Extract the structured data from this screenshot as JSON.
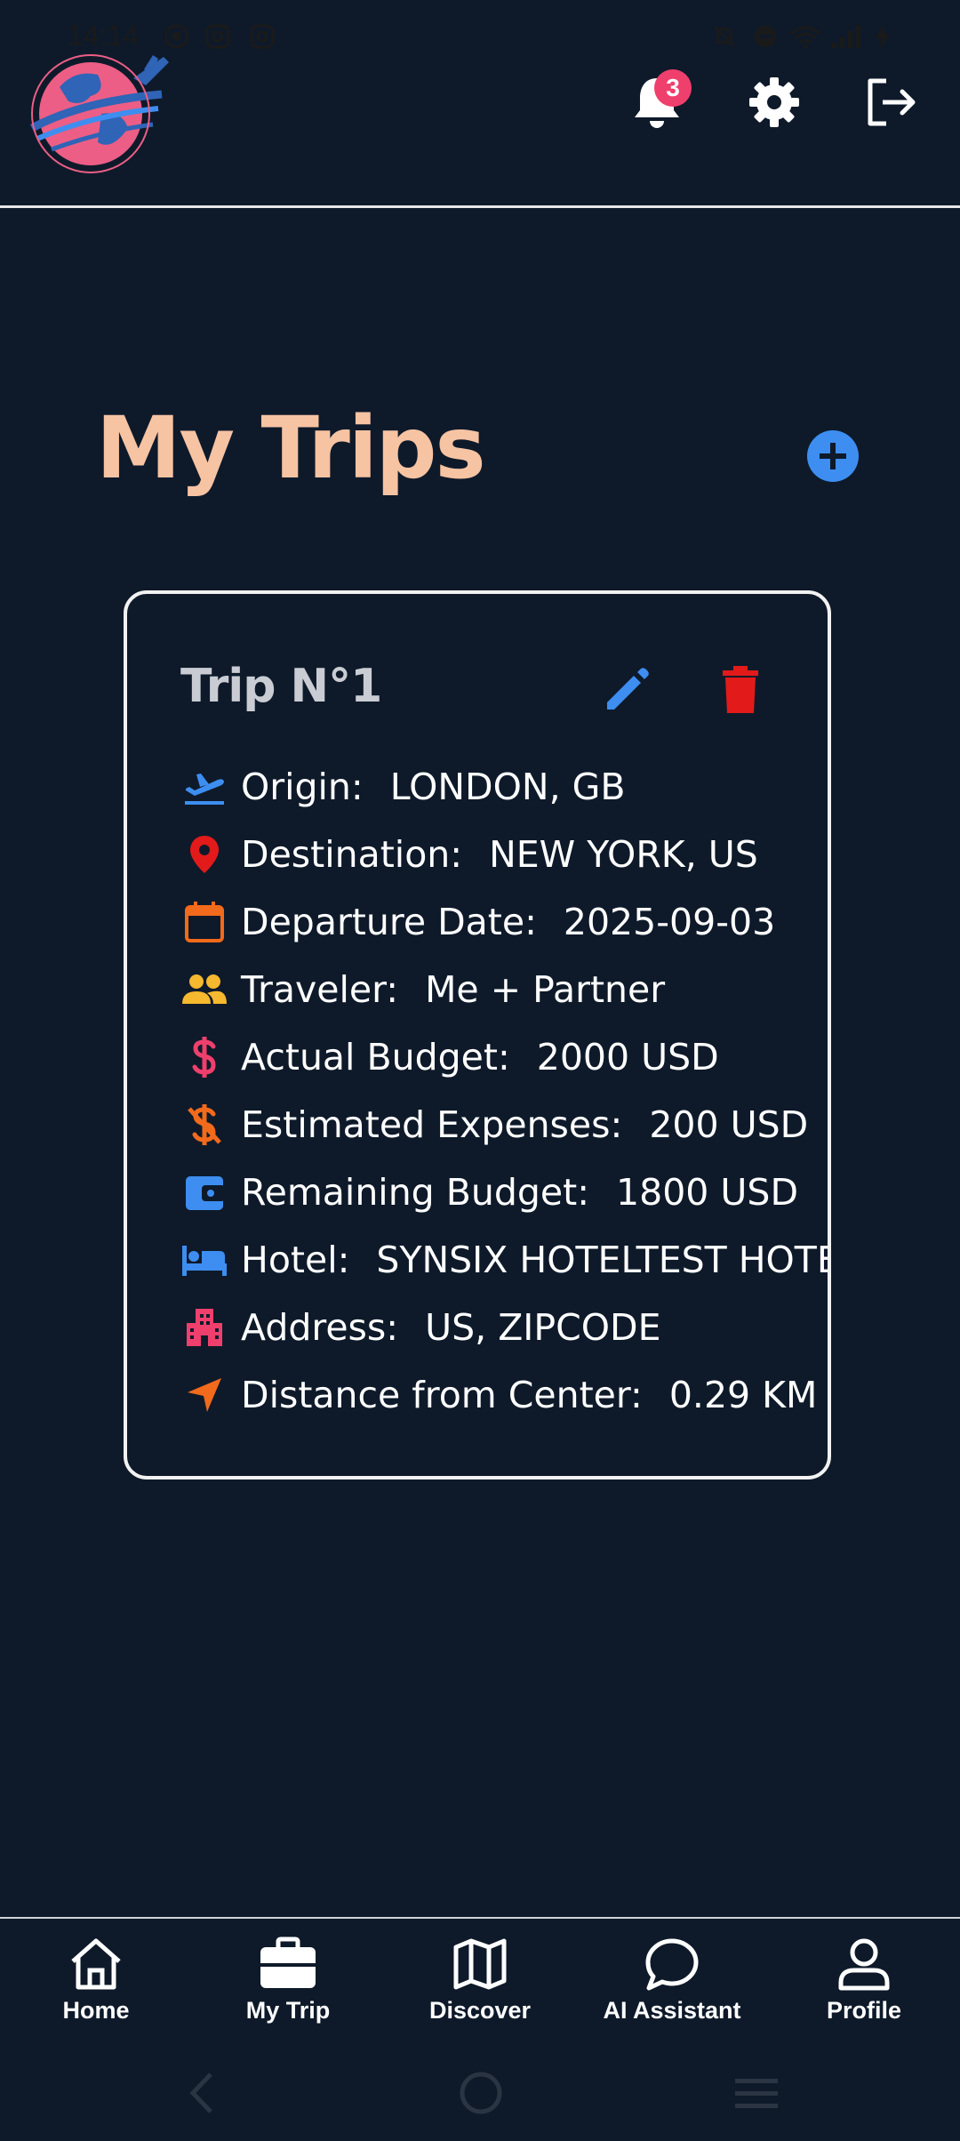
{
  "status_bar": {
    "time": "14:14",
    "left_icons": [
      "app-icon",
      "instagram-icon",
      "instagram-icon"
    ],
    "right_icons": [
      "bell-off-icon",
      "dnd-icon",
      "wifi-icon",
      "signal-icon",
      "battery-icon"
    ]
  },
  "header": {
    "logo": "globe-airplane-logo",
    "notification_count": "3",
    "icons": [
      "bell-icon",
      "gear-icon",
      "logout-icon"
    ]
  },
  "page": {
    "title": "My Trips",
    "add_icon": "plus-circle-icon"
  },
  "trip": {
    "title": "Trip N°1",
    "details": [
      {
        "icon": "plane-departure-icon",
        "label": "Origin:",
        "value": "LONDON, GB",
        "color": "#3d8ef0"
      },
      {
        "icon": "map-pin-icon",
        "label": "Destination:",
        "value": "NEW YORK, US",
        "color": "#e21a1a"
      },
      {
        "icon": "calendar-icon",
        "label": "Departure Date:",
        "value": "2025-09-03",
        "color": "#f26a1b"
      },
      {
        "icon": "people-icon",
        "label": "Traveler:",
        "value": "Me + Partner",
        "color": "#f5b82e"
      },
      {
        "icon": "dollar-icon",
        "label": "Actual Budget:",
        "value": "2000 USD",
        "color": "#ef3f6c"
      },
      {
        "icon": "dollar-off-icon",
        "label": "Estimated Expenses:",
        "value": "200 USD",
        "color": "#f26a1b"
      },
      {
        "icon": "wallet-icon",
        "label": "Remaining Budget:",
        "value": "1800 USD",
        "color": "#3d8ef0"
      },
      {
        "icon": "bed-icon",
        "label": "Hotel:",
        "value": "SYNSIX HOTELTEST HOTEL",
        "color": "#3d8ef0"
      },
      {
        "icon": "city-icon",
        "label": "Address:",
        "value": "US, ZIPCODE",
        "color": "#ef3f6c"
      },
      {
        "icon": "navigation-arrow-icon",
        "label": "Distance from Center:",
        "value": "0.29 KM",
        "color": "#f26a1b"
      }
    ]
  },
  "bottom_nav": [
    {
      "icon": "home-icon",
      "label": "Home"
    },
    {
      "icon": "briefcase-icon",
      "label": "My Trip",
      "active": true
    },
    {
      "icon": "map-icon",
      "label": "Discover"
    },
    {
      "icon": "chat-bubble-icon",
      "label": "AI Assistant"
    },
    {
      "icon": "user-icon",
      "label": "Profile"
    }
  ],
  "colors": {
    "background": "#0e1a2a",
    "title": "#f6c3a3",
    "accent_blue": "#3d8ef0",
    "delete_red": "#e21a1a",
    "badge_pink": "#ef3f6c"
  }
}
